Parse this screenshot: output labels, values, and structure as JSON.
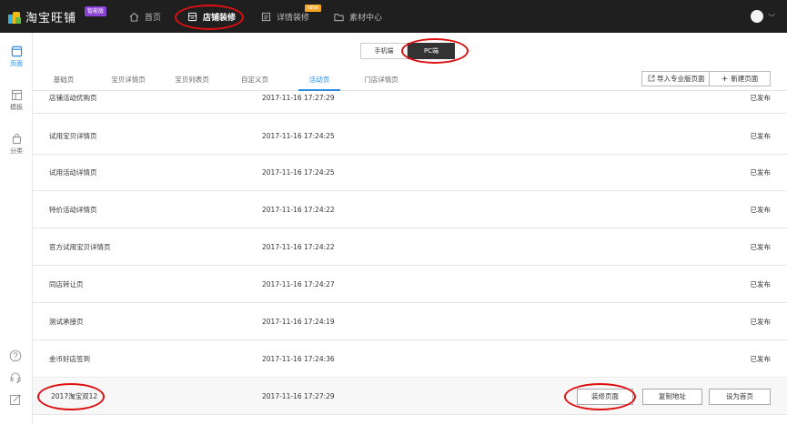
{
  "topbar": {
    "brand": "淘宝旺铺",
    "brand_badge": "智能版",
    "nav": [
      {
        "label": "首页"
      },
      {
        "label": "店铺装修"
      },
      {
        "label": "详情装修",
        "badge": "NEW"
      },
      {
        "label": "素材中心"
      }
    ]
  },
  "sidebar": {
    "items": [
      {
        "label": "页面"
      },
      {
        "label": "模板"
      },
      {
        "label": "分类"
      }
    ]
  },
  "device_toggle": {
    "mobile": "手机端",
    "pc": "PC端",
    "selected": "PC端"
  },
  "tabs": [
    {
      "label": "基础页"
    },
    {
      "label": "宝贝详情页"
    },
    {
      "label": "宝贝列表页"
    },
    {
      "label": "自定义页"
    },
    {
      "label": "活动页"
    },
    {
      "label": "门店详情页"
    }
  ],
  "active_tab": "活动页",
  "header_buttons": {
    "import": "导入专业版页面",
    "new_page": "新建页面"
  },
  "pages": [
    {
      "name": "店铺活动优购页",
      "time": "2017-11-16 17:27:29",
      "status": "已发布"
    },
    {
      "name": "试用宝贝详情页",
      "time": "2017-11-16 17:24:25",
      "status": "已发布"
    },
    {
      "name": "试用活动详情页",
      "time": "2017-11-16 17:24:25",
      "status": "已发布"
    },
    {
      "name": "特价活动详情页",
      "time": "2017-11-16 17:24:22",
      "status": "已发布"
    },
    {
      "name": "官方试用宝贝详情页",
      "time": "2017-11-16 17:24:22",
      "status": "已发布"
    },
    {
      "name": "同店转让页",
      "time": "2017-11-16 17:24:27",
      "status": "已发布"
    },
    {
      "name": "测试承接页",
      "time": "2017-11-16 17:24:19",
      "status": "已发布"
    },
    {
      "name": "金币好店签到",
      "time": "2017-11-16 17:24:36",
      "status": "已发布"
    },
    {
      "name": "2017淘宝双12",
      "time": "2017-11-16 17:27:29",
      "status": ""
    }
  ],
  "row_actions": {
    "edit": "装修页面",
    "copy": "复制地址",
    "set_home": "设为首页"
  },
  "colors": {
    "topbar_bg": "#1f1f1f",
    "accent": "#2d8ce0",
    "annotation": "#e01010",
    "brand_badge": "#8a42d6",
    "new_badge": "#f5a623"
  }
}
